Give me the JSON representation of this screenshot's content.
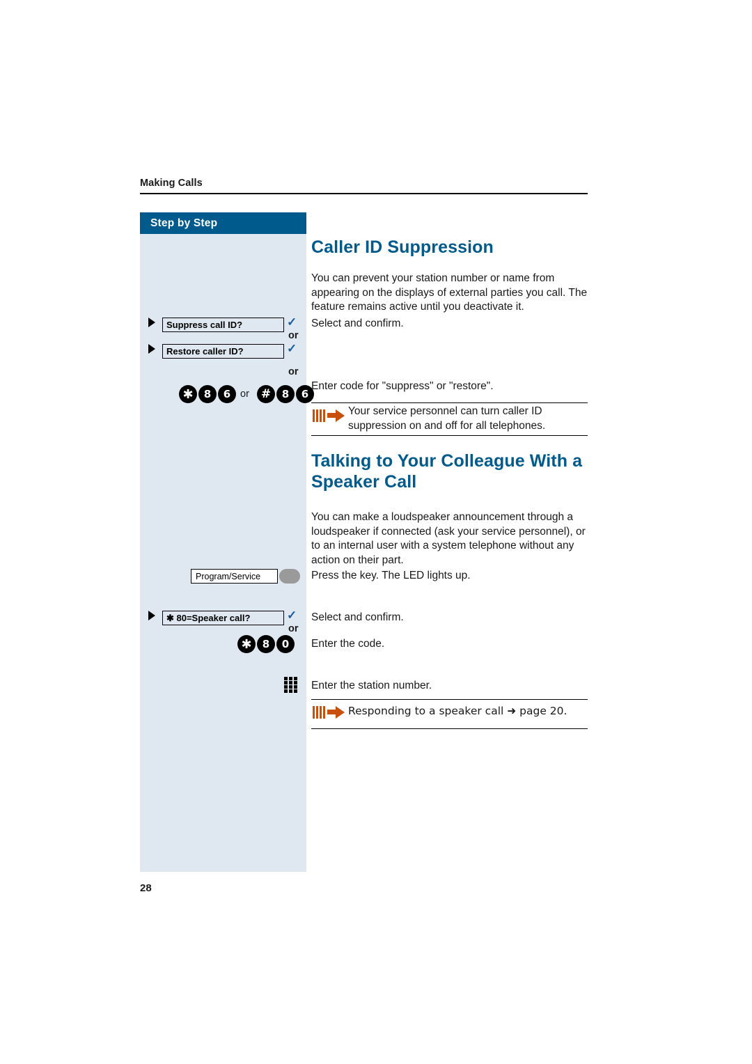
{
  "page": {
    "running_header": "Making Calls",
    "page_number": "28"
  },
  "sidebar": {
    "title": "Step by Step",
    "menu_items": [
      {
        "label": "Suppress call ID?",
        "confirm": "✓"
      },
      {
        "label": "Restore caller ID?",
        "confirm": "✓"
      },
      {
        "label": "✱ 80=Speaker call?",
        "confirm": "✓"
      }
    ],
    "or_labels": {
      "first": "or",
      "second": "or",
      "third": "or"
    },
    "codes": {
      "suppress": [
        "✱",
        "8",
        "6"
      ],
      "restore": [
        "#",
        "8",
        "6"
      ],
      "code_joiner": "or",
      "speaker_call": [
        "✱",
        "8",
        "0"
      ]
    },
    "program_service_key": {
      "label": "Program/Service",
      "led_name": "led-indicator"
    }
  },
  "main": {
    "sections": [
      {
        "heading": "Caller ID Suppression",
        "intro": "You can prevent your station number or name from appearing on the displays of external parties you call. The feature remains active until you deactivate it.",
        "steps": [
          "Select and confirm.",
          "Enter code for \"suppress\" or \"restore\"."
        ],
        "note": "Your service personnel can turn caller ID suppression on and off for all telephones."
      },
      {
        "heading": "Talking to Your Colleague With a Speaker Call",
        "intro": "You can make a loudspeaker announcement through a loudspeaker if connected (ask your service personnel), or to an internal user with a system telephone without any action on their part.",
        "steps": [
          "Press the key. The LED lights up.",
          "Select and confirm.",
          "Enter the code.",
          "Enter the station number."
        ],
        "note": "Responding to a speaker call ➜ page 20."
      }
    ]
  },
  "colors": {
    "accent_blue": "#005a8c",
    "panel_blue": "#dfe8f0",
    "note_orange": "#c8500a"
  }
}
